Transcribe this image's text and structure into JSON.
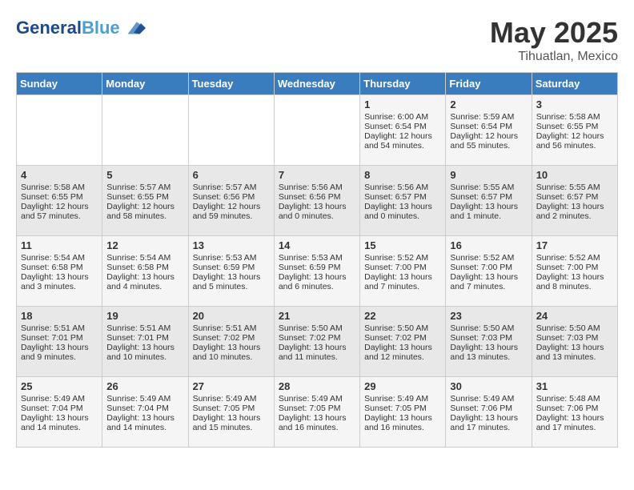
{
  "header": {
    "logo_line1": "General",
    "logo_line2": "Blue",
    "month_year": "May 2025",
    "location": "Tihuatlan, Mexico"
  },
  "weekdays": [
    "Sunday",
    "Monday",
    "Tuesday",
    "Wednesday",
    "Thursday",
    "Friday",
    "Saturday"
  ],
  "weeks": [
    [
      {
        "day": "",
        "info": ""
      },
      {
        "day": "",
        "info": ""
      },
      {
        "day": "",
        "info": ""
      },
      {
        "day": "",
        "info": ""
      },
      {
        "day": "1",
        "info": "Sunrise: 6:00 AM\nSunset: 6:54 PM\nDaylight: 12 hours and 54 minutes."
      },
      {
        "day": "2",
        "info": "Sunrise: 5:59 AM\nSunset: 6:54 PM\nDaylight: 12 hours and 55 minutes."
      },
      {
        "day": "3",
        "info": "Sunrise: 5:58 AM\nSunset: 6:55 PM\nDaylight: 12 hours and 56 minutes."
      }
    ],
    [
      {
        "day": "4",
        "info": "Sunrise: 5:58 AM\nSunset: 6:55 PM\nDaylight: 12 hours and 57 minutes."
      },
      {
        "day": "5",
        "info": "Sunrise: 5:57 AM\nSunset: 6:55 PM\nDaylight: 12 hours and 58 minutes."
      },
      {
        "day": "6",
        "info": "Sunrise: 5:57 AM\nSunset: 6:56 PM\nDaylight: 12 hours and 59 minutes."
      },
      {
        "day": "7",
        "info": "Sunrise: 5:56 AM\nSunset: 6:56 PM\nDaylight: 13 hours and 0 minutes."
      },
      {
        "day": "8",
        "info": "Sunrise: 5:56 AM\nSunset: 6:57 PM\nDaylight: 13 hours and 0 minutes."
      },
      {
        "day": "9",
        "info": "Sunrise: 5:55 AM\nSunset: 6:57 PM\nDaylight: 13 hours and 1 minute."
      },
      {
        "day": "10",
        "info": "Sunrise: 5:55 AM\nSunset: 6:57 PM\nDaylight: 13 hours and 2 minutes."
      }
    ],
    [
      {
        "day": "11",
        "info": "Sunrise: 5:54 AM\nSunset: 6:58 PM\nDaylight: 13 hours and 3 minutes."
      },
      {
        "day": "12",
        "info": "Sunrise: 5:54 AM\nSunset: 6:58 PM\nDaylight: 13 hours and 4 minutes."
      },
      {
        "day": "13",
        "info": "Sunrise: 5:53 AM\nSunset: 6:59 PM\nDaylight: 13 hours and 5 minutes."
      },
      {
        "day": "14",
        "info": "Sunrise: 5:53 AM\nSunset: 6:59 PM\nDaylight: 13 hours and 6 minutes."
      },
      {
        "day": "15",
        "info": "Sunrise: 5:52 AM\nSunset: 7:00 PM\nDaylight: 13 hours and 7 minutes."
      },
      {
        "day": "16",
        "info": "Sunrise: 5:52 AM\nSunset: 7:00 PM\nDaylight: 13 hours and 7 minutes."
      },
      {
        "day": "17",
        "info": "Sunrise: 5:52 AM\nSunset: 7:00 PM\nDaylight: 13 hours and 8 minutes."
      }
    ],
    [
      {
        "day": "18",
        "info": "Sunrise: 5:51 AM\nSunset: 7:01 PM\nDaylight: 13 hours and 9 minutes."
      },
      {
        "day": "19",
        "info": "Sunrise: 5:51 AM\nSunset: 7:01 PM\nDaylight: 13 hours and 10 minutes."
      },
      {
        "day": "20",
        "info": "Sunrise: 5:51 AM\nSunset: 7:02 PM\nDaylight: 13 hours and 10 minutes."
      },
      {
        "day": "21",
        "info": "Sunrise: 5:50 AM\nSunset: 7:02 PM\nDaylight: 13 hours and 11 minutes."
      },
      {
        "day": "22",
        "info": "Sunrise: 5:50 AM\nSunset: 7:02 PM\nDaylight: 13 hours and 12 minutes."
      },
      {
        "day": "23",
        "info": "Sunrise: 5:50 AM\nSunset: 7:03 PM\nDaylight: 13 hours and 13 minutes."
      },
      {
        "day": "24",
        "info": "Sunrise: 5:50 AM\nSunset: 7:03 PM\nDaylight: 13 hours and 13 minutes."
      }
    ],
    [
      {
        "day": "25",
        "info": "Sunrise: 5:49 AM\nSunset: 7:04 PM\nDaylight: 13 hours and 14 minutes."
      },
      {
        "day": "26",
        "info": "Sunrise: 5:49 AM\nSunset: 7:04 PM\nDaylight: 13 hours and 14 minutes."
      },
      {
        "day": "27",
        "info": "Sunrise: 5:49 AM\nSunset: 7:05 PM\nDaylight: 13 hours and 15 minutes."
      },
      {
        "day": "28",
        "info": "Sunrise: 5:49 AM\nSunset: 7:05 PM\nDaylight: 13 hours and 16 minutes."
      },
      {
        "day": "29",
        "info": "Sunrise: 5:49 AM\nSunset: 7:05 PM\nDaylight: 13 hours and 16 minutes."
      },
      {
        "day": "30",
        "info": "Sunrise: 5:49 AM\nSunset: 7:06 PM\nDaylight: 13 hours and 17 minutes."
      },
      {
        "day": "31",
        "info": "Sunrise: 5:48 AM\nSunset: 7:06 PM\nDaylight: 13 hours and 17 minutes."
      }
    ]
  ]
}
